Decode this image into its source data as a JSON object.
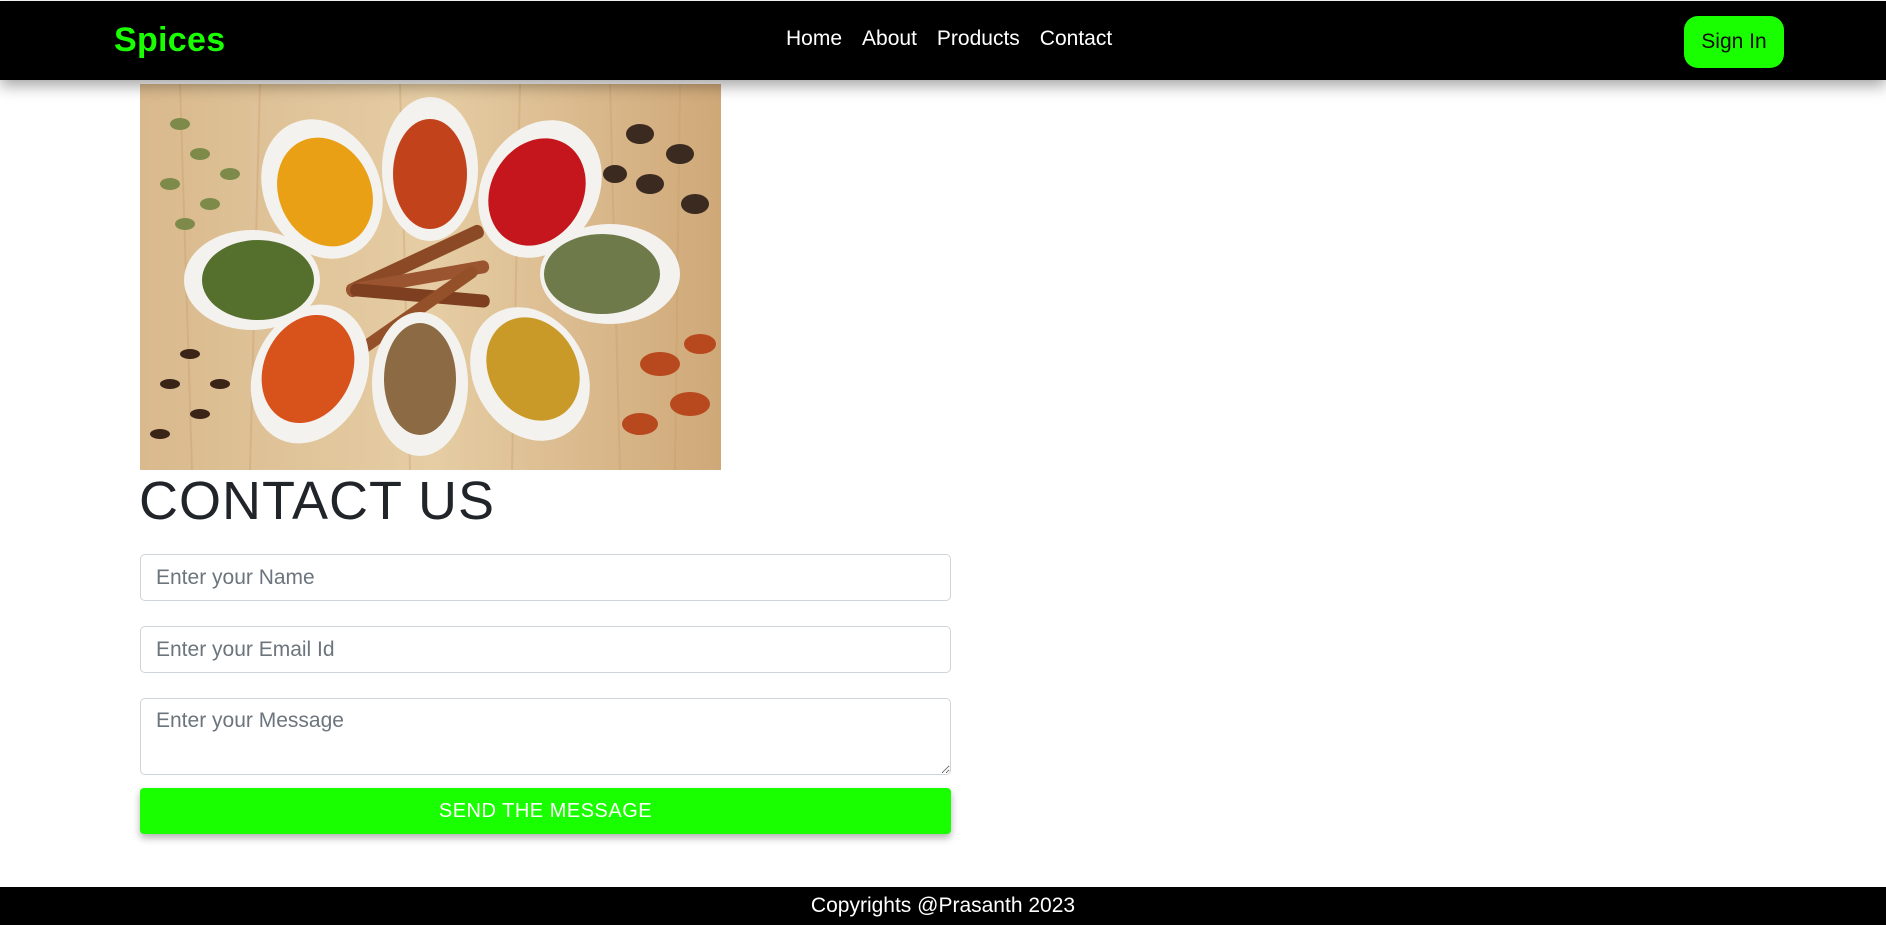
{
  "header": {
    "brand": "Spices",
    "nav": [
      "Home",
      "About",
      "Products",
      "Contact"
    ],
    "signin_label": "Sign In"
  },
  "hero": {
    "image_name": "spices-image"
  },
  "contact": {
    "title": "CONTACT US",
    "name_placeholder": "Enter your Name",
    "email_placeholder": "Enter your Email Id",
    "message_placeholder": "Enter your Message",
    "send_label": "SEND THE MESSAGE"
  },
  "footer": {
    "text": "Copyrights @Prasanth 2023"
  },
  "colors": {
    "accent": "#19ff00",
    "bar": "#000000",
    "title": "#212529"
  }
}
